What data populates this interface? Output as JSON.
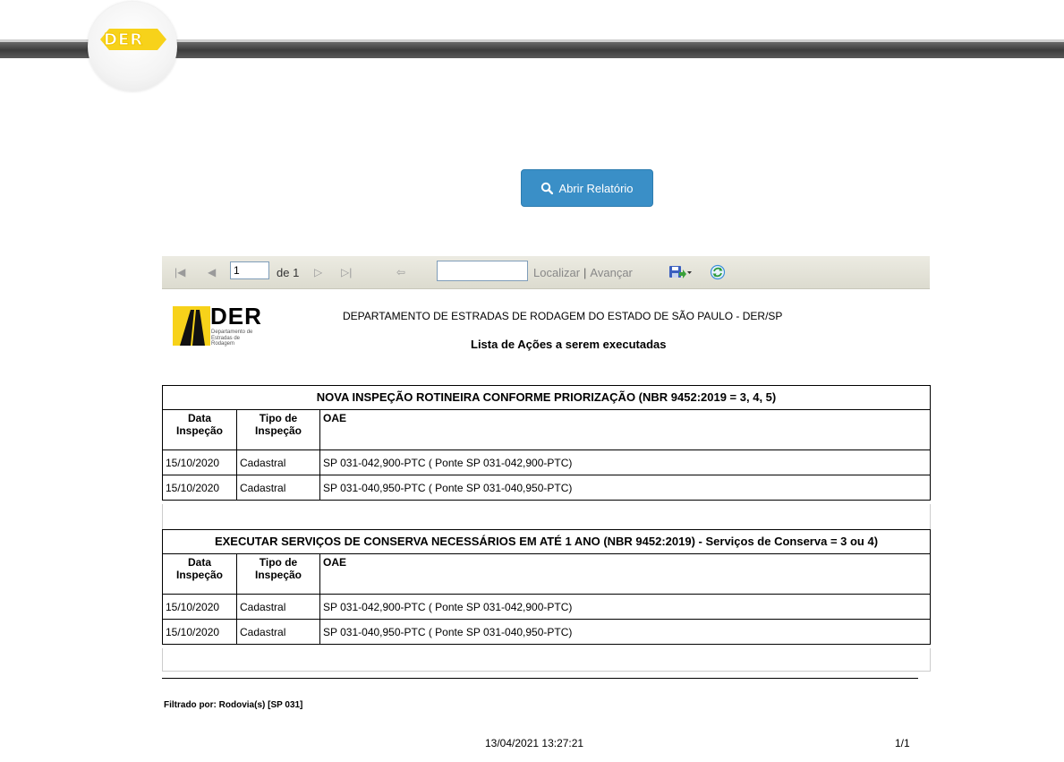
{
  "header": {
    "logo_text": "DER"
  },
  "actions": {
    "open_report_label": "Abrir Relatório"
  },
  "toolbar": {
    "page_value": "1",
    "page_of": "de 1",
    "find_label": "Localizar",
    "next_label": "Avançar",
    "find_value": ""
  },
  "report": {
    "logo_text": "DER",
    "logo_sub1": "Departamento de",
    "logo_sub2": "Estradas de Rodagem",
    "title": "DEPARTAMENTO DE ESTRADAS DE RODAGEM DO ESTADO DE SÃO PAULO - DER/SP",
    "subtitle": "Lista de Ações a serem executadas",
    "columns": {
      "date": "Data Inspeção",
      "type": "Tipo de Inspeção",
      "oae": "OAE"
    },
    "sections": [
      {
        "title": "NOVA INSPEÇÃO ROTINEIRA CONFORME PRIORIZAÇÃO (NBR 9452:2019 = 3, 4, 5)",
        "rows": [
          {
            "date": "15/10/2020",
            "type": "Cadastral",
            "oae": "SP 031-042,900-PTC ( Ponte SP 031-042,900-PTC)"
          },
          {
            "date": "15/10/2020",
            "type": "Cadastral",
            "oae": "SP 031-040,950-PTC ( Ponte SP 031-040,950-PTC)"
          }
        ]
      },
      {
        "title": "EXECUTAR SERVIÇOS DE CONSERVA NECESSÁRIOS EM ATÉ 1 ANO (NBR 9452:2019) - Serviços de Conserva = 3 ou 4)",
        "rows": [
          {
            "date": "15/10/2020",
            "type": "Cadastral",
            "oae": "SP 031-042,900-PTC ( Ponte SP 031-042,900-PTC)"
          },
          {
            "date": "15/10/2020",
            "type": "Cadastral",
            "oae": "SP 031-040,950-PTC ( Ponte SP 031-040,950-PTC)"
          }
        ]
      }
    ],
    "filter": "Filtrado por: Rodovia(s) [SP 031]",
    "timestamp": "13/04/2021 13:27:21",
    "page": "1/1"
  }
}
